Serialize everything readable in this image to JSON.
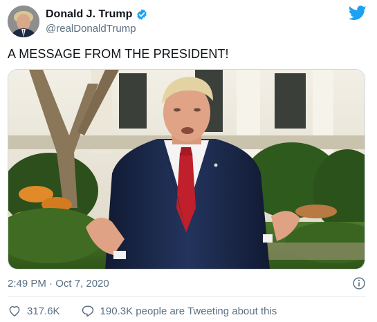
{
  "author": {
    "display_name": "Donald J. Trump",
    "handle": "@realDonaldTrump",
    "verified_icon": "verified-badge-icon"
  },
  "tweet": {
    "text": "A MESSAGE FROM THE PRESIDENT!",
    "timestamp": "2:49 PM · Oct 7, 2020"
  },
  "engagement": {
    "likes": "317.6K",
    "tweeting": "190.3K people are Tweeting about this"
  },
  "icons": {
    "brand": "twitter-bird-icon",
    "info": "info-icon",
    "like": "heart-icon",
    "reply": "reply-bubble-icon"
  },
  "colors": {
    "brand_blue": "#1da1f2",
    "secondary_text": "#5b7083",
    "primary_text": "#0f1419"
  }
}
